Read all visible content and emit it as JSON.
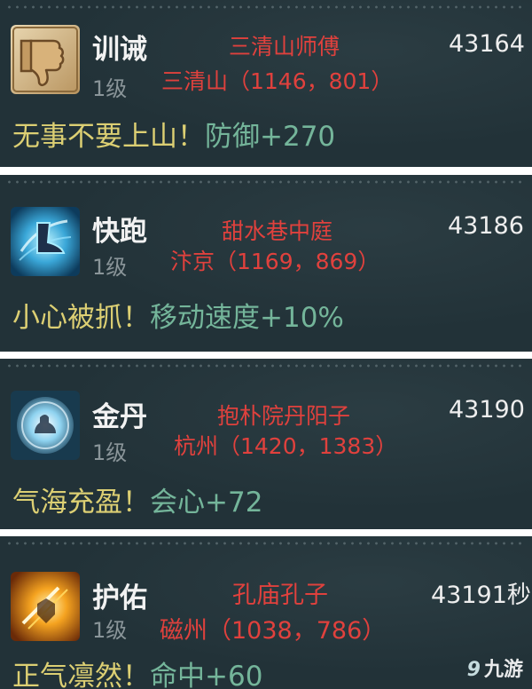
{
  "cards": [
    {
      "name": "训诫",
      "level": "1级",
      "npc": "三清山师傅",
      "location": "三清山（1146，801）",
      "id": "43164",
      "desc_text": "无事不要上山！",
      "desc_effect": "防御+270",
      "icon": "thumbs-down-icon"
    },
    {
      "name": "快跑",
      "level": "1级",
      "npc": "甜水巷中庭",
      "location": "汴京（1169，869）",
      "id": "43186",
      "desc_text": "小心被抓！",
      "desc_effect": "移动速度+10%",
      "icon": "running-boot-icon"
    },
    {
      "name": "金丹",
      "level": "1级",
      "npc": "抱朴院丹阳子",
      "location": "杭州（1420，1383）",
      "id": "43190",
      "desc_text": "气海充盈！",
      "desc_effect": "会心+72",
      "icon": "meditation-orb-icon"
    },
    {
      "name": "护佑",
      "level": "1级",
      "npc": "孔庙孔子",
      "location": "磁州（1038，786）",
      "id": "43191秒",
      "desc_text": "正气凛然！",
      "desc_effect": "命中+60",
      "icon": "golden-shield-icon"
    }
  ],
  "watermark": {
    "logo": "9",
    "text": "九游"
  }
}
